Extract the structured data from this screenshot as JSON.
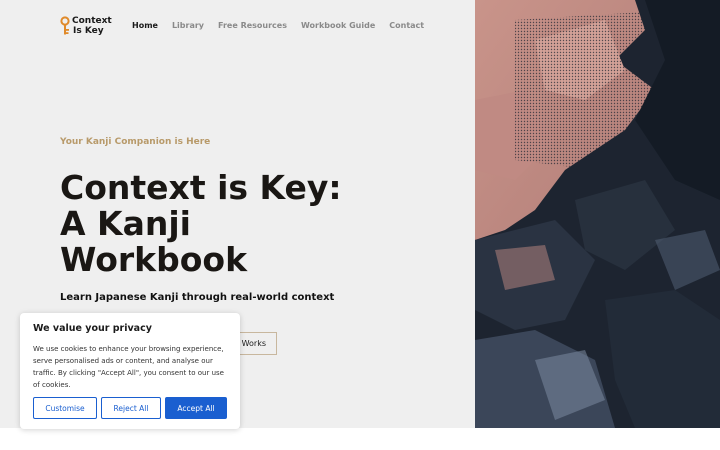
{
  "header": {
    "logo": {
      "line1": "Context",
      "line2": "Is Key",
      "icon": "key-icon",
      "accent": "#e08a2a"
    },
    "nav": [
      {
        "label": "Home",
        "active": true
      },
      {
        "label": "Library",
        "active": false
      },
      {
        "label": "Free Resources",
        "active": false
      },
      {
        "label": "Workbook Guide",
        "active": false
      },
      {
        "label": "Contact",
        "active": false
      }
    ]
  },
  "hero": {
    "eyebrow": "Your Kanji Companion is Here",
    "title": "Context is Key: A Kanji Workbook",
    "subtitle": "Learn Japanese Kanji through real-world context",
    "secondary_button": "t Works",
    "eyebrow_color": "#b89a6a"
  },
  "cookie_banner": {
    "title": "We value your privacy",
    "body": "We use cookies to enhance your browsing experience, serve personalised ads or content, and analyse our traffic. By clicking \"Accept All\", you consent to our use of cookies.",
    "customise": "Customise",
    "reject": "Reject All",
    "accept": "Accept All",
    "accent": "#1a5fd0"
  },
  "artwork": {
    "name": "abstract-painting",
    "colors": [
      "#1d2430",
      "#c9948a",
      "#7c8aa0"
    ]
  }
}
